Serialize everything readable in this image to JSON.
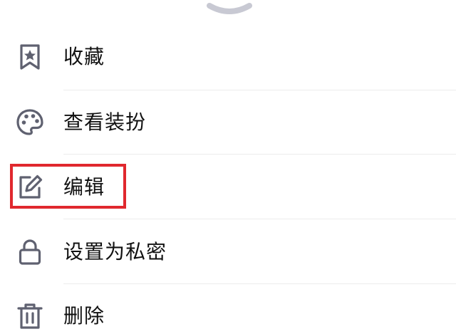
{
  "menu": {
    "items": [
      {
        "label": "收藏",
        "icon": "bookmark-star-icon"
      },
      {
        "label": "查看装扮",
        "icon": "palette-icon"
      },
      {
        "label": "编辑",
        "icon": "edit-icon"
      },
      {
        "label": "设置为私密",
        "icon": "lock-icon"
      },
      {
        "label": "删除",
        "icon": "trash-icon"
      }
    ]
  },
  "colors": {
    "icon": "#5f6170",
    "text": "#111111",
    "divider": "#ececec",
    "highlight": "#e0282e",
    "handle": "#c8c9d3"
  }
}
